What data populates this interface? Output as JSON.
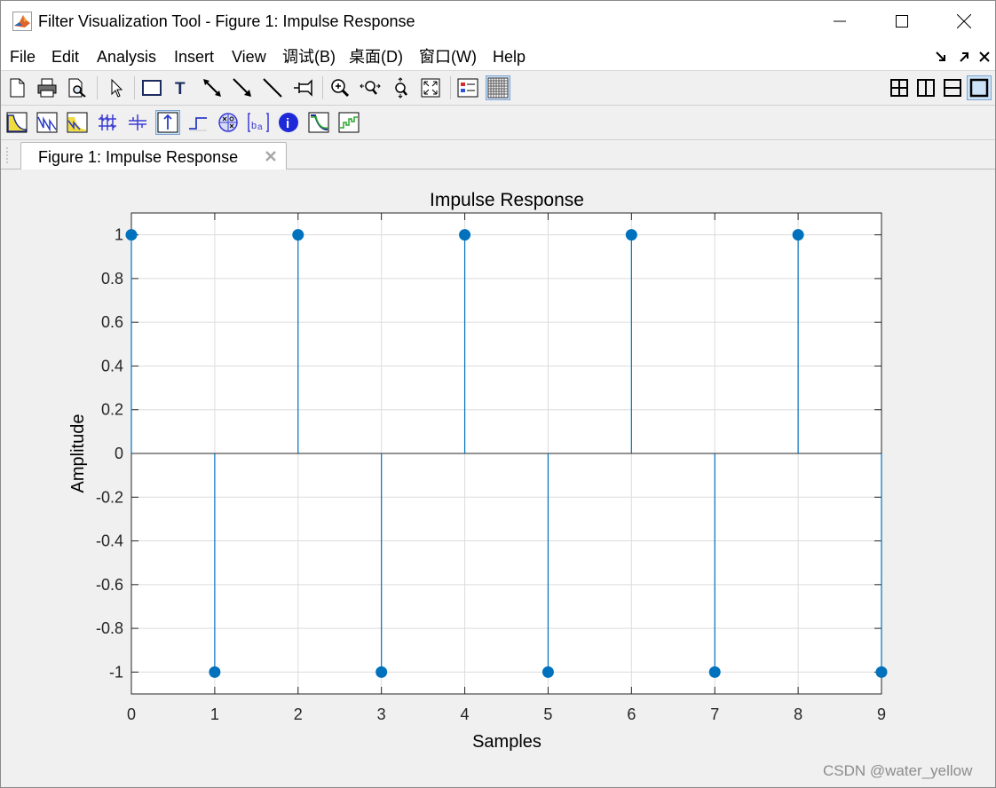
{
  "window": {
    "title": "Filter Visualization Tool - Figure 1: Impulse Response"
  },
  "menu": {
    "items": [
      {
        "label": "File"
      },
      {
        "label": "Edit"
      },
      {
        "label": "Analysis"
      },
      {
        "label": "Insert"
      },
      {
        "label": "View"
      },
      {
        "label": "调试(B)"
      },
      {
        "label": "桌面(D)"
      },
      {
        "label": "窗口(W)"
      },
      {
        "label": "Help"
      }
    ]
  },
  "tab": {
    "label": "Figure 1: Impulse Response"
  },
  "chart_data": {
    "type": "stem",
    "title": "Impulse Response",
    "xlabel": "Samples",
    "ylabel": "Amplitude",
    "xlim": [
      0,
      9
    ],
    "ylim": [
      -1.1,
      1.1
    ],
    "xticks": [
      "0",
      "1",
      "2",
      "3",
      "4",
      "5",
      "6",
      "7",
      "8",
      "9"
    ],
    "yticks": [
      "1",
      "0.8",
      "0.6",
      "0.4",
      "0.2",
      "0",
      "-0.2",
      "-0.4",
      "-0.6",
      "-0.8",
      "-1"
    ],
    "grid": true,
    "color": "#0072bd",
    "x": [
      0,
      1,
      2,
      3,
      4,
      5,
      6,
      7,
      8,
      9
    ],
    "y": [
      1,
      -1,
      1,
      -1,
      1,
      -1,
      1,
      -1,
      1,
      -1
    ]
  },
  "watermark": "CSDN @water_yellow"
}
